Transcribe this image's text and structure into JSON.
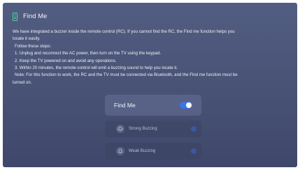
{
  "header": {
    "icon": "remote-control-icon",
    "title": "Find Me"
  },
  "description": {
    "intro_line1": "We have integrated a buzzer inside the remote control (RC). If you cannot find the RC, the Find me function helps you",
    "intro_line2": "locate it easily.",
    "steps_heading": "Follow these steps:",
    "step1": "1. Unplug and reconnect the AC power, then turn on the TV using the keypad.",
    "step2": "2. Keep the TV powered on and avoid any operations.",
    "step3": "3. Within 20 minutes, the remote control will emit a buzzing sound to help you locate it.",
    "note_line1": "Note: For this function to work, the RC and the TV must be connected via Bluetooth, and the Find me function must be",
    "note_line2": "turned on."
  },
  "find_me_toggle": {
    "label": "Find Me",
    "state": "on"
  },
  "options": [
    {
      "label": "Strong Buzzing",
      "icon": "bell-ringing-icon",
      "selected": false
    },
    {
      "label": "Weak Buzzing",
      "icon": "bell-icon",
      "selected": false
    }
  ],
  "colors": {
    "background": "#4b557a",
    "accent": "#3b74e6",
    "text": "#eef0f6",
    "dim_text": "#b9bfd3"
  }
}
